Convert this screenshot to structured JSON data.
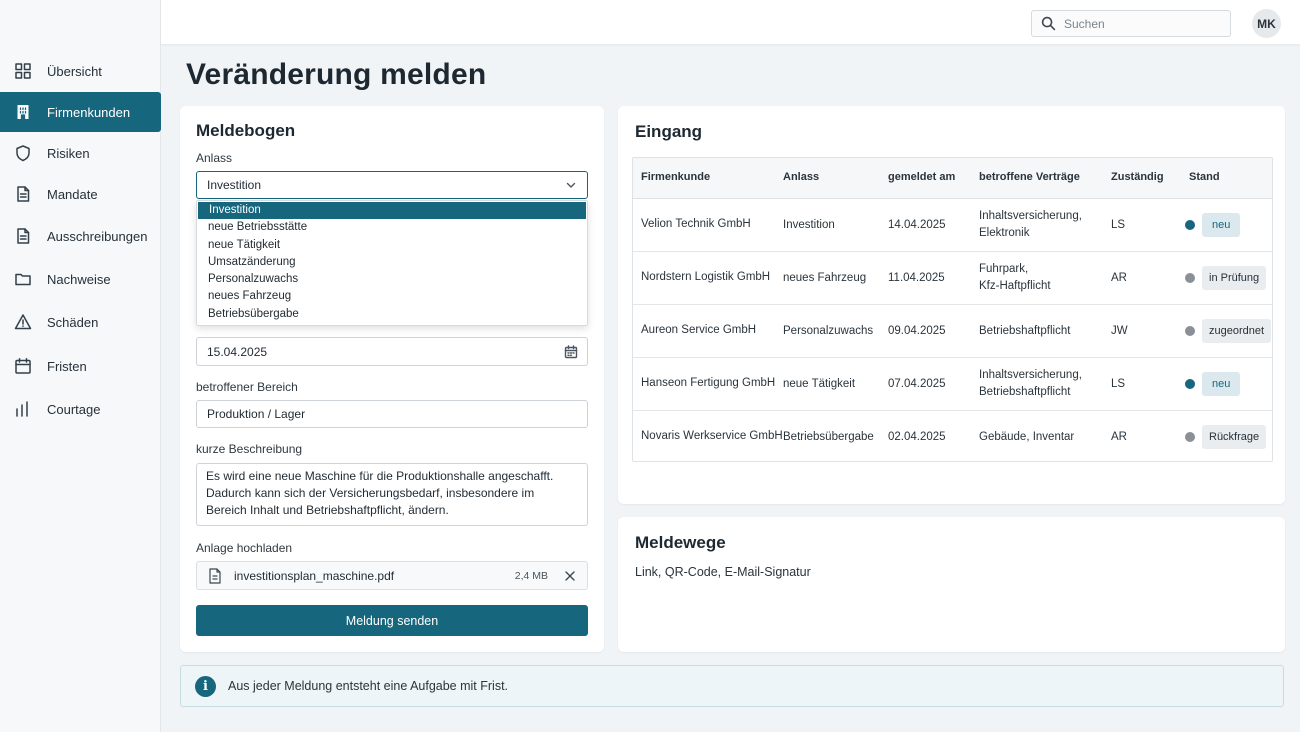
{
  "sidebar": {
    "items": [
      {
        "label": "Übersicht",
        "icon": "grid-icon"
      },
      {
        "label": "Firmenkunden",
        "icon": "building-icon",
        "active": true
      },
      {
        "label": "Risiken",
        "icon": "shield-icon"
      },
      {
        "label": "Mandate",
        "icon": "document-icon"
      },
      {
        "label": "Ausschreibungen",
        "icon": "document-icon"
      },
      {
        "label": "Nachweise",
        "icon": "folder-icon"
      },
      {
        "label": "Schäden",
        "icon": "warning-icon"
      },
      {
        "label": "Fristen",
        "icon": "calendar-icon"
      },
      {
        "label": "Courtage",
        "icon": "bar-chart-icon"
      }
    ]
  },
  "header": {
    "search_placeholder": "Suchen",
    "avatar_initials": "MK"
  },
  "page": {
    "title": "Veränderung melden"
  },
  "form": {
    "title": "Meldebogen",
    "anlass_label": "Anlass",
    "anlass_value": "Investition",
    "anlass_options": [
      "Investition",
      "neue Betriebsstätte",
      "neue Tätigkeit",
      "Umsatzänderung",
      "Personalzuwachs",
      "neues Fahrzeug",
      "Betriebsübergabe"
    ],
    "date_value": "15.04.2025",
    "bereich_label": "betroffener Bereich",
    "bereich_value": "Produktion / Lager",
    "beschreibung_label": "kurze Beschreibung",
    "beschreibung_value": "Es wird eine neue Maschine für die Produktionshalle angeschafft. Dadurch kann sich der Versicherungsbedarf, insbesondere im Bereich Inhalt und Betriebshaftpflicht, ändern.",
    "upload_label": "Anlage hochladen",
    "file_name": "investitionsplan_maschine.pdf",
    "file_size": "2,4 MB",
    "submit_label": "Meldung senden"
  },
  "inbox": {
    "title": "Eingang",
    "columns": [
      "Firmenkunde",
      "Anlass",
      "gemeldet am",
      "betroffene Verträge",
      "Zuständig",
      "Stand"
    ],
    "rows": [
      {
        "kunde": "Velion Technik GmbH",
        "anlass": "Investition",
        "datum": "14.04.2025",
        "vertraege": [
          "Inhaltsversicherung,",
          "Elektronik"
        ],
        "zustaendig": "LS",
        "stand": "neu",
        "status_color": "#16667d"
      },
      {
        "kunde": "Nordstern Logistik GmbH",
        "anlass": "neues Fahrzeug",
        "datum": "11.04.2025",
        "vertraege": [
          "Fuhrpark,",
          "Kfz-Haftpflicht"
        ],
        "zustaendig": "AR",
        "stand": "in Prüfung",
        "status_color": "#8a9096"
      },
      {
        "kunde": "Aureon Service GmbH",
        "anlass": "Personalzuwachs",
        "datum": "09.04.2025",
        "vertraege": [
          "Betriebshaftpflicht"
        ],
        "zustaendig": "JW",
        "stand": "zugeordnet",
        "status_color": "#8a9096"
      },
      {
        "kunde": "Hanseon Fertigung GmbH",
        "anlass": "neue Tätigkeit",
        "datum": "07.04.2025",
        "vertraege": [
          "Inhaltsversicherung,",
          "Betriebshaftpflicht"
        ],
        "zustaendig": "LS",
        "stand": "neu",
        "status_color": "#16667d"
      },
      {
        "kunde": "Novaris Werkservice GmbH",
        "anlass": "Betriebsübergabe",
        "datum": "02.04.2025",
        "vertraege": [
          "Gebäude, Inventar"
        ],
        "zustaendig": "AR",
        "stand": "Rückfrage",
        "status_color": "#8a9096"
      }
    ]
  },
  "channels": {
    "title": "Meldewege",
    "text": "Link, QR-Code, E-Mail-Signatur"
  },
  "info": {
    "icon": "info-icon",
    "text": "Aus jeder Meldung entsteht eine Aufgabe mit Frist."
  },
  "colors": {
    "accent": "#16667d",
    "neutral_status": "#8a9096"
  }
}
